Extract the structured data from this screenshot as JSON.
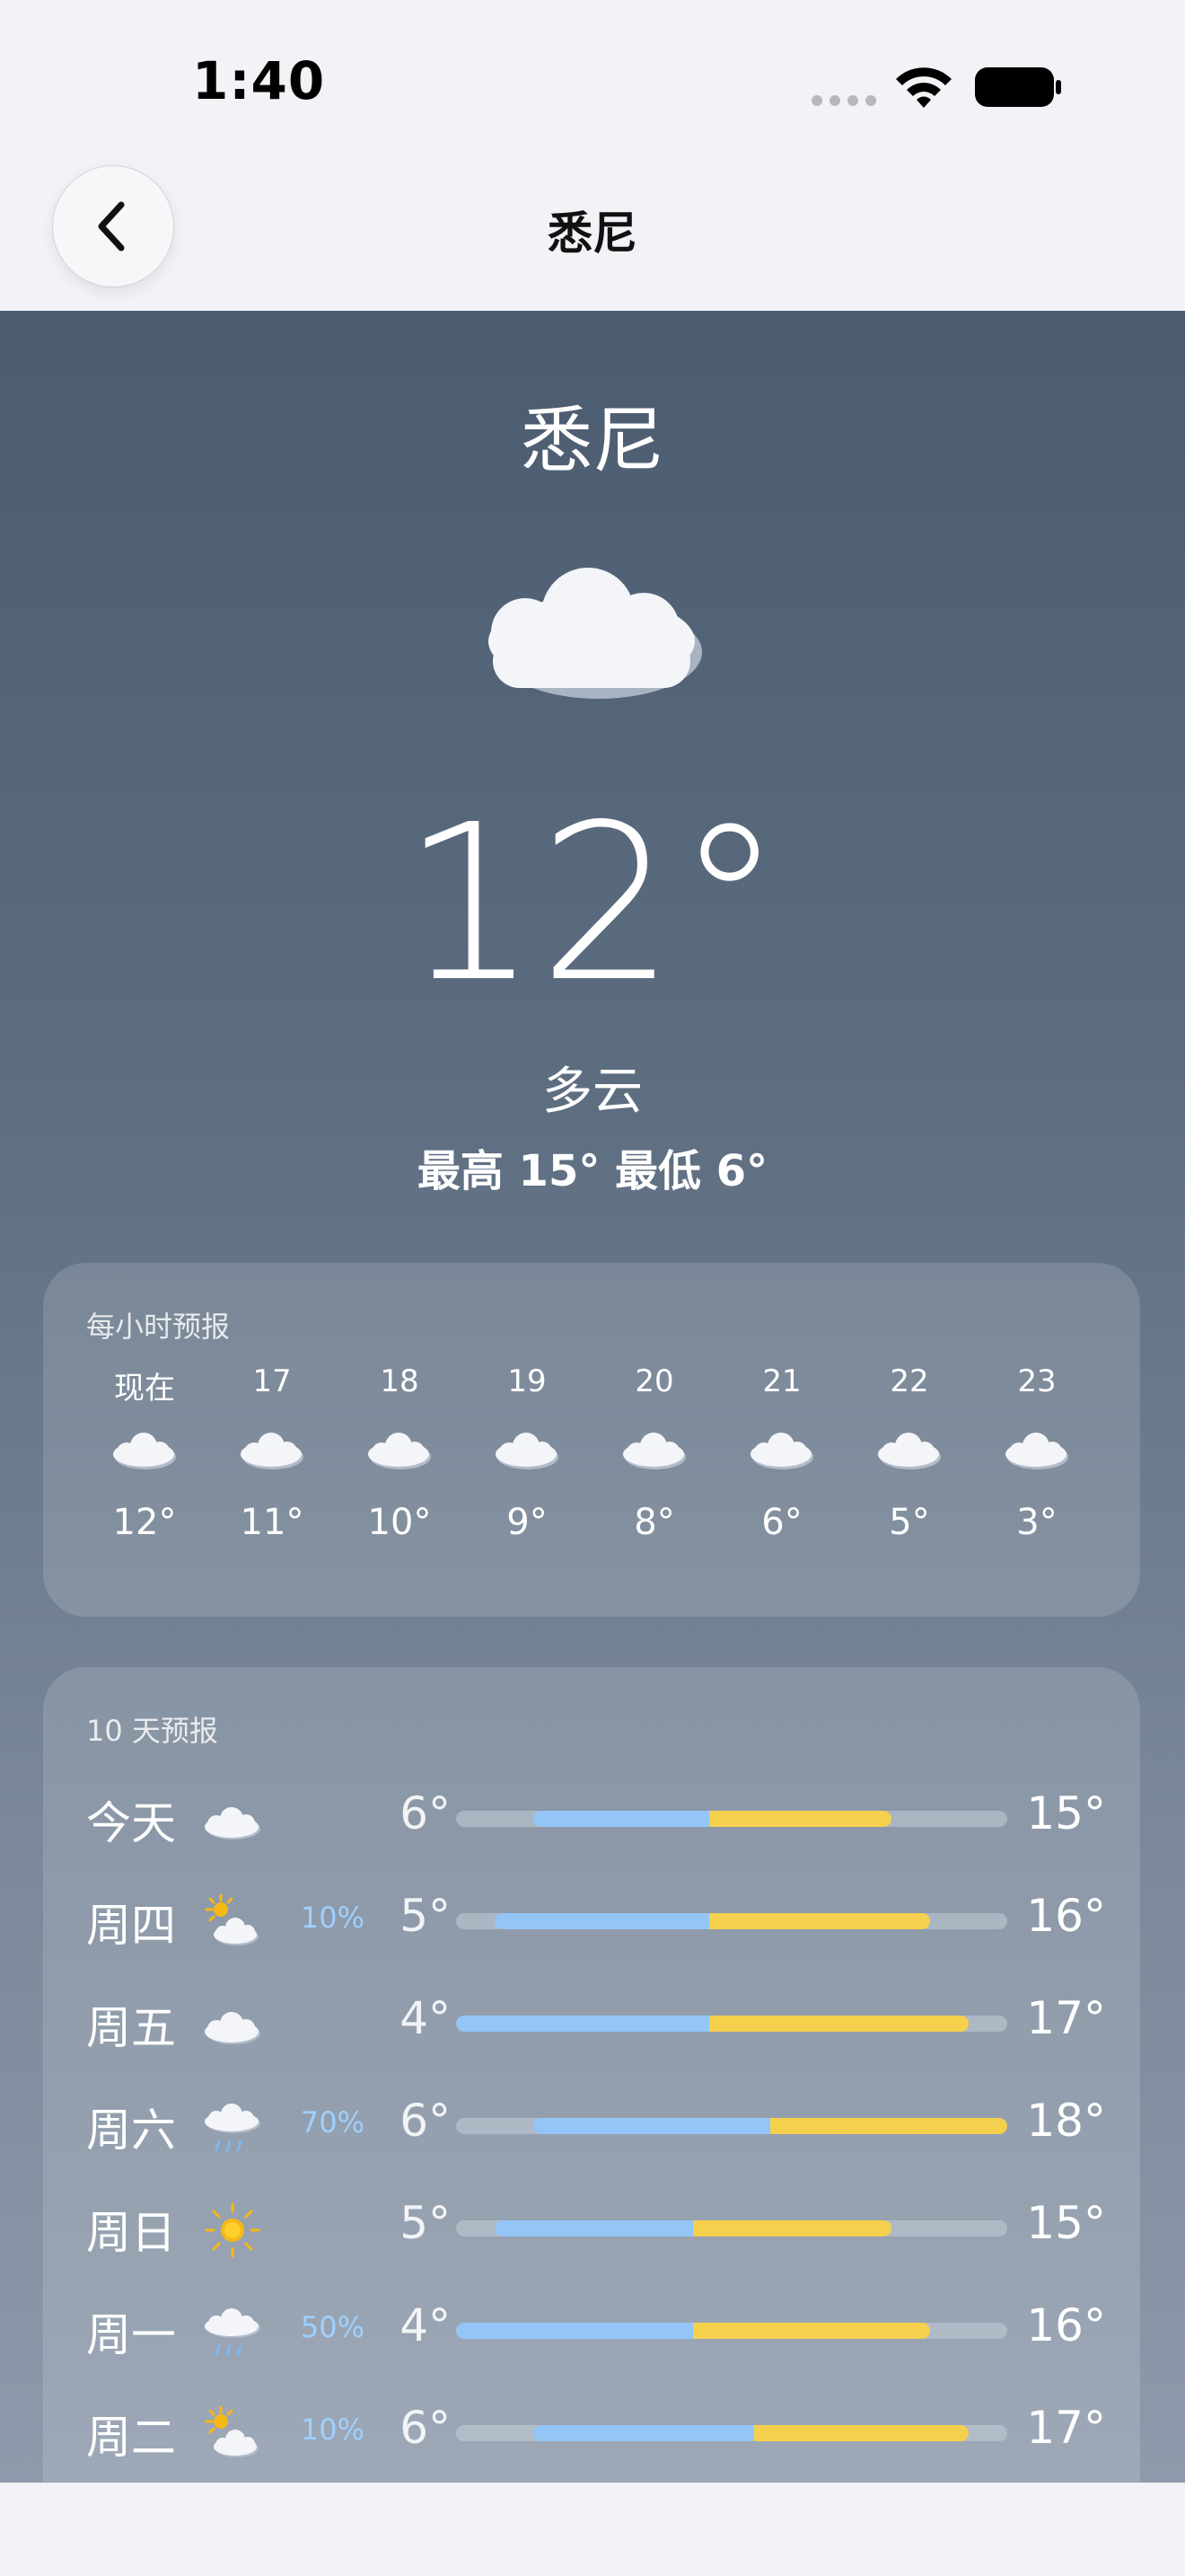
{
  "status": {
    "time": "1:40"
  },
  "nav": {
    "title": "悉尼"
  },
  "current": {
    "city": "悉尼",
    "temp": "12°",
    "condition": "多云",
    "hilo": "最高 15° 最低 6°"
  },
  "hourly": {
    "title": "每小时预报",
    "items": [
      {
        "label": "现在",
        "icon": "cloud-icon",
        "temp": "12°"
      },
      {
        "label": "17",
        "icon": "cloud-icon",
        "temp": "11°"
      },
      {
        "label": "18",
        "icon": "cloud-icon",
        "temp": "10°"
      },
      {
        "label": "19",
        "icon": "cloud-icon",
        "temp": "9°"
      },
      {
        "label": "20",
        "icon": "cloud-icon",
        "temp": "8°"
      },
      {
        "label": "21",
        "icon": "cloud-icon",
        "temp": "6°"
      },
      {
        "label": "22",
        "icon": "cloud-icon",
        "temp": "5°"
      },
      {
        "label": "23",
        "icon": "cloud-icon",
        "temp": "3°"
      }
    ]
  },
  "daily": {
    "title": "10 天预报",
    "days": [
      {
        "name": "今天",
        "icon": "cloud-icon",
        "precip": "",
        "low": "6°",
        "high": "15°",
        "range_start": 0.14,
        "range_split": 0.46,
        "range_end": 0.79
      },
      {
        "name": "周四",
        "icon": "partly-sunny-icon",
        "precip": "10%",
        "low": "5°",
        "high": "16°",
        "range_start": 0.07,
        "range_split": 0.46,
        "range_end": 0.86
      },
      {
        "name": "周五",
        "icon": "cloud-icon",
        "precip": "",
        "low": "4°",
        "high": "17°",
        "range_start": 0.0,
        "range_split": 0.46,
        "range_end": 0.93
      },
      {
        "name": "周六",
        "icon": "rain-icon",
        "precip": "70%",
        "low": "6°",
        "high": "18°",
        "range_start": 0.14,
        "range_split": 0.57,
        "range_end": 1.0
      },
      {
        "name": "周日",
        "icon": "sun-icon",
        "precip": "",
        "low": "5°",
        "high": "15°",
        "range_start": 0.07,
        "range_split": 0.43,
        "range_end": 0.79
      },
      {
        "name": "周一",
        "icon": "rain-icon",
        "precip": "50%",
        "low": "4°",
        "high": "16°",
        "range_start": 0.0,
        "range_split": 0.43,
        "range_end": 0.86
      },
      {
        "name": "周二",
        "icon": "partly-sunny-icon",
        "precip": "10%",
        "low": "6°",
        "high": "17°",
        "range_start": 0.14,
        "range_split": 0.54,
        "range_end": 0.93
      }
    ]
  },
  "colors": {
    "cool_bar": "#93c6f7",
    "warm_bar": "#f5d04d",
    "precip_text": "#9fd0ff"
  }
}
